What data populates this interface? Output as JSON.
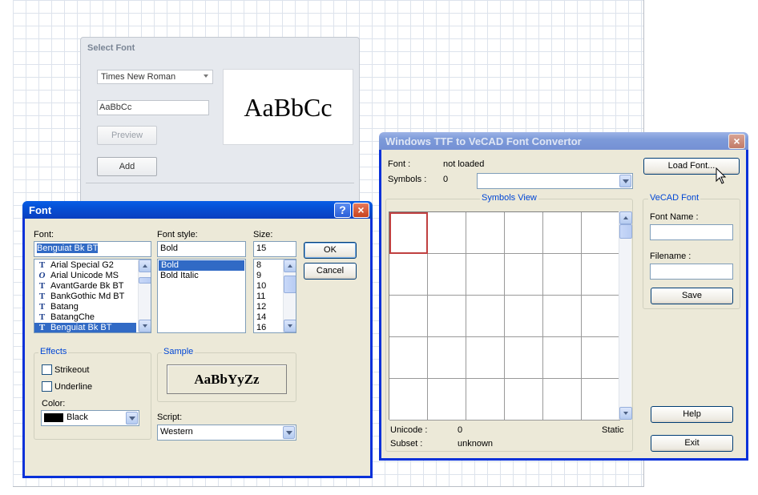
{
  "select_font": {
    "title": "Select Font",
    "font_combo": "Times New Roman",
    "sample_input": "AaBbCc",
    "preview_button": "Preview",
    "add_button": "Add",
    "preview_text": "AaBbCc"
  },
  "font_dialog": {
    "title": "Font",
    "font_label": "Font:",
    "font_value": "Benguiat Bk BT",
    "fonts": [
      {
        "name": "Arial Special G2",
        "icon": "truetype-icon"
      },
      {
        "name": "Arial Unicode MS",
        "icon": "opentype-icon"
      },
      {
        "name": "AvantGarde Bk BT",
        "icon": "truetype-icon"
      },
      {
        "name": "BankGothic Md BT",
        "icon": "truetype-icon"
      },
      {
        "name": "Batang",
        "icon": "truetype-icon"
      },
      {
        "name": "BatangChe",
        "icon": "truetype-icon"
      },
      {
        "name": "Benguiat Bk BT",
        "icon": "truetype-icon",
        "selected": true
      }
    ],
    "style_label": "Font style:",
    "style_value": "Bold",
    "styles": [
      "Bold",
      "Bold Italic"
    ],
    "size_label": "Size:",
    "size_value": "15",
    "sizes": [
      "8",
      "9",
      "10",
      "11",
      "12",
      "14",
      "16"
    ],
    "ok_button": "OK",
    "cancel_button": "Cancel",
    "effects_label": "Effects",
    "strikeout_label": "Strikeout",
    "underline_label": "Underline",
    "color_label": "Color:",
    "color_value": "Black",
    "sample_label": "Sample",
    "sample_text": "AaBbYyZz",
    "script_label": "Script:",
    "script_value": "Western"
  },
  "convertor": {
    "title": "Windows TTF to VeCAD Font Convertor",
    "font_label": "Font :",
    "font_status": "not loaded",
    "symbols_label": "Symbols :",
    "symbols_count": "0",
    "load_font_button": "Load Font...",
    "symbols_view_label": "Symbols View",
    "vecad_font_label": "VeCAD Font",
    "font_name_label": "Font Name :",
    "filename_label": "Filename :",
    "save_button": "Save",
    "help_button": "Help",
    "exit_button": "Exit",
    "unicode_label": "Unicode :",
    "unicode_value": "0",
    "static_label": "Static",
    "subset_label": "Subset :",
    "subset_value": "unknown"
  }
}
